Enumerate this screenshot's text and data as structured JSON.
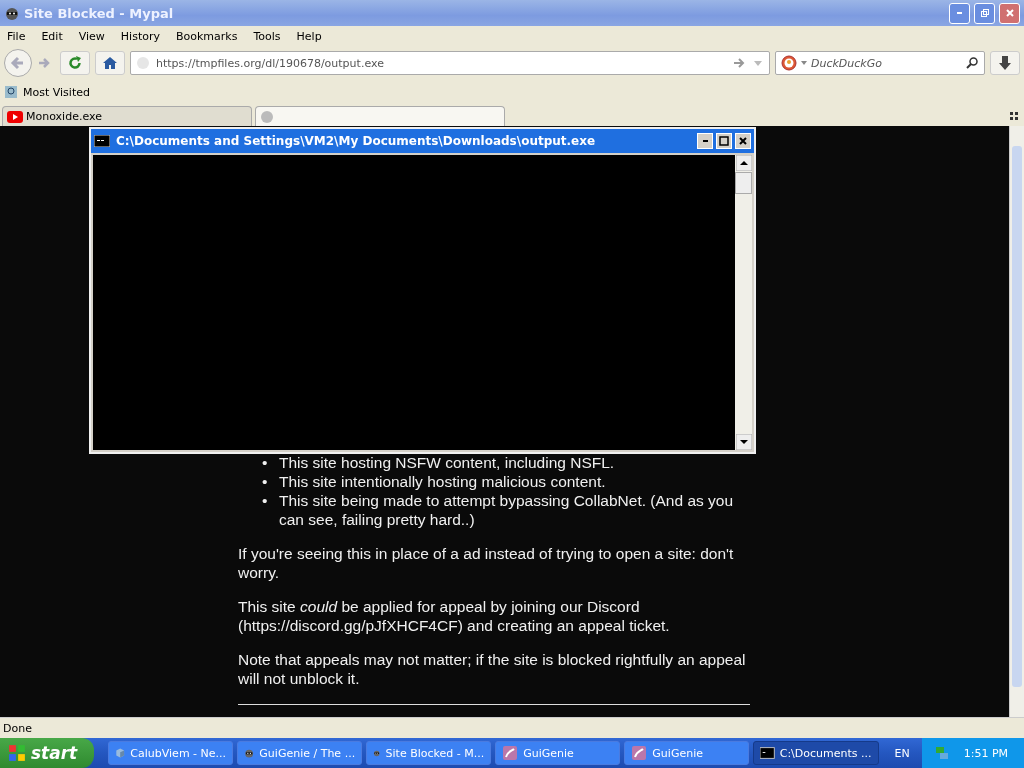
{
  "window": {
    "title": "Site Blocked - Mypal"
  },
  "menu": [
    "File",
    "Edit",
    "View",
    "History",
    "Bookmarks",
    "Tools",
    "Help"
  ],
  "address": {
    "value": "https://tmpfiles.org/dl/190678/output.exe"
  },
  "search": {
    "placeholder": "DuckDuckGo"
  },
  "bookmarks": [
    "Most Visited"
  ],
  "tabs": [
    {
      "label": "Monoxide.exe",
      "selected": false
    },
    {
      "selected": true
    }
  ],
  "page": {
    "marker": "•",
    "bullets": [
      "This site hosting NSFW content, including NSFL.",
      "This site intentionally hosting malicious content.",
      "This site being made to attempt bypassing CollabNet. (And as you can see, failing pretty hard..)"
    ],
    "paragraphs": [
      "If you're seeing this in place of a ad instead of trying to open a site: don't worry.",
      "This site *could* be applied for appeal by joining our Discord (https://discord.gg/pJfXHCF4CF) and creating an appeal ticket.",
      "Note that appeals may not matter; if the site is blocked rightfully an appeal will not unblock it."
    ]
  },
  "console": {
    "title": "C:\\Documents and Settings\\VM2\\My Documents\\Downloads\\output.exe"
  },
  "status_bar": "Done",
  "taskbar": {
    "start": "start",
    "items": [
      {
        "label": "CalubViem - Ne...",
        "kind": "cube",
        "selected": false
      },
      {
        "label": "GuiGenie / The ...",
        "kind": "raccoon",
        "selected": false
      },
      {
        "label": "Site Blocked - M...",
        "kind": "raccoon",
        "selected": false
      },
      {
        "label": "GuiGenie",
        "kind": "genie",
        "selected": false
      },
      {
        "label": "GuiGenie",
        "kind": "genie",
        "selected": false
      },
      {
        "label": "C:\\Documents ...",
        "kind": "console",
        "selected": true
      }
    ],
    "language": "EN",
    "clock": "1:51 PM"
  }
}
